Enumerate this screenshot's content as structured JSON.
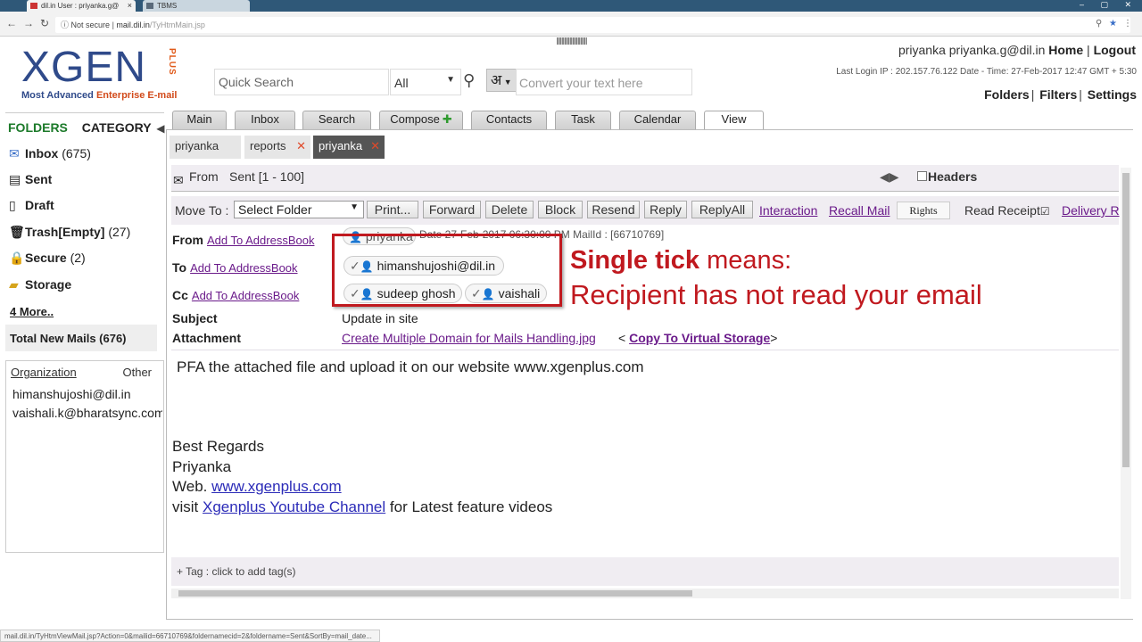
{
  "browser": {
    "tabs": [
      {
        "label": "dil.in User : priyanka.g@"
      },
      {
        "label": "TBMS"
      }
    ],
    "url": {
      "security": "Not secure",
      "host": "mail.dil.in",
      "path": "/TyHtmMain.jsp"
    }
  },
  "header": {
    "logo_word": "XGEN",
    "logo_plus": "PLUS",
    "tagline_a": "Most Advanced",
    "tagline_b": "Enterprise E-mail",
    "quick_search_placeholder": "Quick Search",
    "search_scope": "All",
    "hindi_label": "अ",
    "convert_placeholder": "Convert your text here",
    "user_text": "priyanka priyanka.g@dil.in",
    "home": "Home",
    "logout": "Logout",
    "last_login": "Last Login IP : 202.157.76.122 Date - Time: 27-Feb-2017 12:47 GMT + 5:30",
    "folders_link": "Folders",
    "filters_link": "Filters",
    "settings_link": "Settings"
  },
  "sidebar": {
    "folders_label": "FOLDERS",
    "category_label": "CATEGORY",
    "items": [
      {
        "label": "Inbox",
        "count": "(675)",
        "icon": "inbox-icon"
      },
      {
        "label": "Sent",
        "count": "",
        "icon": "sent-icon"
      },
      {
        "label": "Draft",
        "count": "",
        "icon": "draft-icon"
      },
      {
        "label": "Trash[Empty]",
        "count": "(27)",
        "icon": "trash-icon"
      },
      {
        "label": "Secure",
        "count": "(2)",
        "icon": "lock-icon"
      },
      {
        "label": "Storage",
        "count": "",
        "icon": "storage-icon"
      }
    ],
    "more": "4 More..",
    "total_new": "Total New Mails (676)",
    "org_tab": "Organization",
    "other_tab": "Other",
    "contacts": [
      "himanshujoshi@dil.in",
      "vaishali.k@bharatsync.com"
    ]
  },
  "main_tabs": [
    "Main",
    "Inbox",
    "Search",
    "Compose",
    "Contacts",
    "Task",
    "Calendar",
    "View"
  ],
  "sub_tabs": [
    "priyanka",
    "reports",
    "priyanka"
  ],
  "mail": {
    "from_label": "From",
    "folder_range": "Sent [1 - 100]",
    "headers_label": "Headers",
    "move_to": "Move To :",
    "select_folder": "Select Folder",
    "buttons": [
      "Print...",
      "Forward",
      "Delete",
      "Block",
      "Resend",
      "Reply",
      "ReplyAll"
    ],
    "links": [
      "Interaction",
      "Recall Mail"
    ],
    "rights": "Rights",
    "read_receipt": "Read Receipt",
    "delivery": "Delivery R",
    "field_from": "From",
    "field_to": "To",
    "field_cc": "Cc",
    "add_to_addressbook": "Add To AddressBook",
    "from_value": "priyanka",
    "date_text": "Date 27-Feb-2017 06:30:00 PM    MailId : [66710769]",
    "to_value": "himanshujoshi@dil.in",
    "cc_values": [
      "sudeep ghosh",
      "vaishali"
    ],
    "subject_label": "Subject",
    "subject": "Update in site",
    "attachment_label": "Attachment",
    "attachment": "Create Multiple Domain for Mails Handling.jpg",
    "copy_vs": "Copy To Virtual Storage",
    "body": "PFA the attached file and upload it on our website www.xgenplus.com",
    "sig_regards": "Best Regards",
    "sig_name": "Priyanka",
    "sig_web_prefix": "Web.",
    "sig_web_link": "www.xgenplus.com",
    "sig_visit_prefix": "visit",
    "sig_visit_link": "Xgenplus Youtube Channel",
    "sig_visit_suffix": "for Latest feature videos",
    "tag_text": "+ Tag : click to add tag(s)"
  },
  "annotation": {
    "line1_bold": "Single tick",
    "line1_rest": "means:",
    "line2": "Recipient has not read your email"
  },
  "status_url": "mail.dil.in/TyHtmViewMail.jsp?Action=0&mailid=66710769&foldernamecid=2&foldername=Sent&SortBy=mail_date..."
}
